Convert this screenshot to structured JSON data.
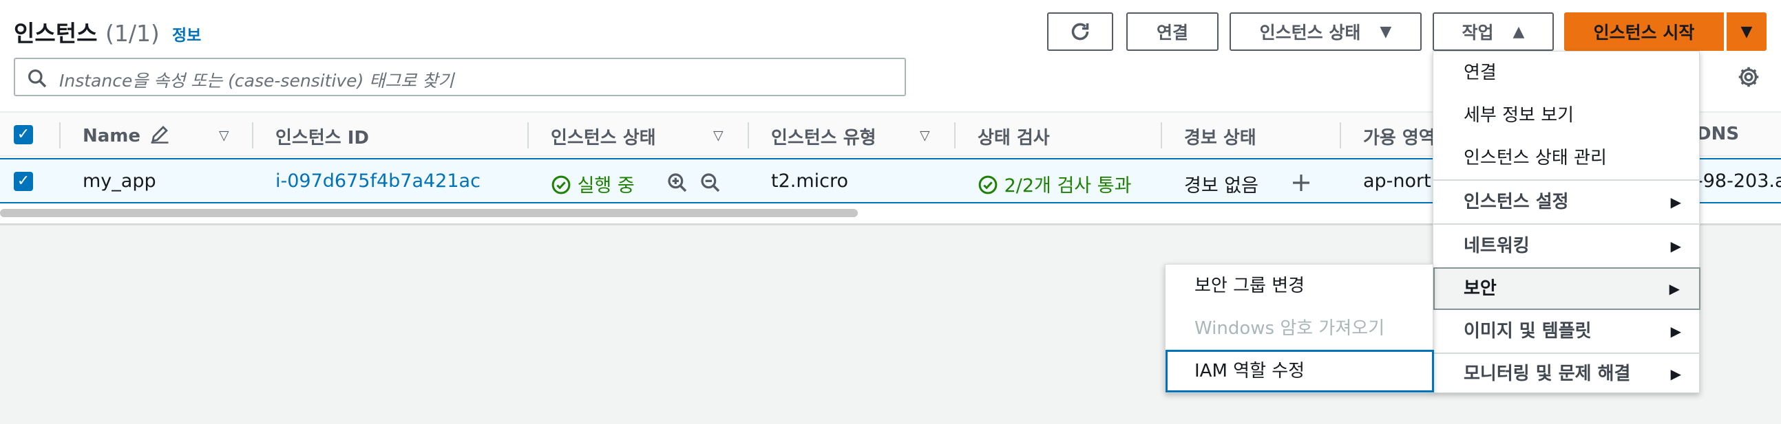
{
  "header": {
    "title": "인스턴스",
    "count": "(1/1)",
    "info_link": "정보"
  },
  "toolbar": {
    "refresh_icon": "refresh-icon",
    "connect_label": "연결",
    "instance_state_label": "인스턴스 상태",
    "actions_label": "작업",
    "launch_label": "인스턴스 시작"
  },
  "search": {
    "placeholder": "Instance을 속성 또는 (case-sensitive) 태그로 찾기"
  },
  "table": {
    "columns": [
      "Name",
      "인스턴스 ID",
      "인스턴스 상태",
      "인스턴스 유형",
      "상태 검사",
      "경보 상태",
      "가용 영역",
      "DNS"
    ],
    "rows": [
      {
        "name": "my_app",
        "instance_id": "i-097d675f4b7a421ac",
        "state": "실행 중",
        "type": "t2.micro",
        "status_check": "2/2개 검사 통과",
        "alarm_status": "경보 없음",
        "availability_zone": "ap-north",
        "dns": "-98-203.a"
      }
    ]
  },
  "actions_menu": {
    "items": [
      {
        "label": "연결",
        "submenu": false
      },
      {
        "label": "세부 정보 보기",
        "submenu": false
      },
      {
        "label": "인스턴스 상태 관리",
        "submenu": false
      },
      {
        "label": "인스턴스 설정",
        "submenu": true
      },
      {
        "label": "네트워킹",
        "submenu": true
      },
      {
        "label": "보안",
        "submenu": true,
        "active": true
      },
      {
        "label": "이미지 및 템플릿",
        "submenu": true
      },
      {
        "label": "모니터링 및 문제 해결",
        "submenu": true
      }
    ]
  },
  "security_submenu": {
    "items": [
      {
        "label": "보안 그룹 변경",
        "disabled": false
      },
      {
        "label": "Windows 암호 가져오기",
        "disabled": true
      },
      {
        "label": "IAM 역할 수정",
        "disabled": false,
        "focused": true
      }
    ]
  },
  "colors": {
    "accent": "#0073bb",
    "primary": "#ec7211",
    "success": "#1d8102"
  }
}
